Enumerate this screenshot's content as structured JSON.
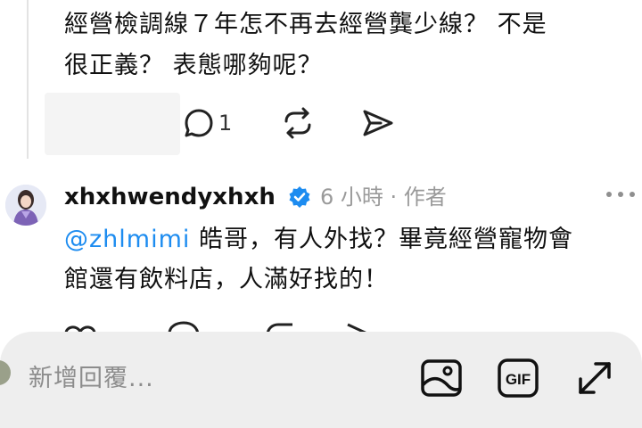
{
  "post": {
    "line1": "經營檢調線７年怎不再去經營龔少線？ 不是",
    "line2": "很正義？ 表態哪夠呢？",
    "reply_count": "1"
  },
  "reply": {
    "username": "xhxhwendyxhxh",
    "meta": "6 小時 · 作者",
    "mention": "@zhlmimi",
    "line1_rest": " 皓哥，有人外找？畢竟經營寵物會",
    "line2": "館還有飲料店，人滿好找的！"
  },
  "composer": {
    "placeholder": "新增回覆..."
  },
  "icons": {
    "comment": "comment-icon",
    "repost": "repost-icon",
    "share": "share-icon",
    "verified": "verified-badge-icon",
    "more": "more-options-icon",
    "image": "image-icon",
    "gif": "gif-icon",
    "expand": "expand-icon"
  },
  "colors": {
    "mention": "#1d8cf0",
    "verified": "#1d8cf0",
    "meta": "#9a9a9a"
  }
}
